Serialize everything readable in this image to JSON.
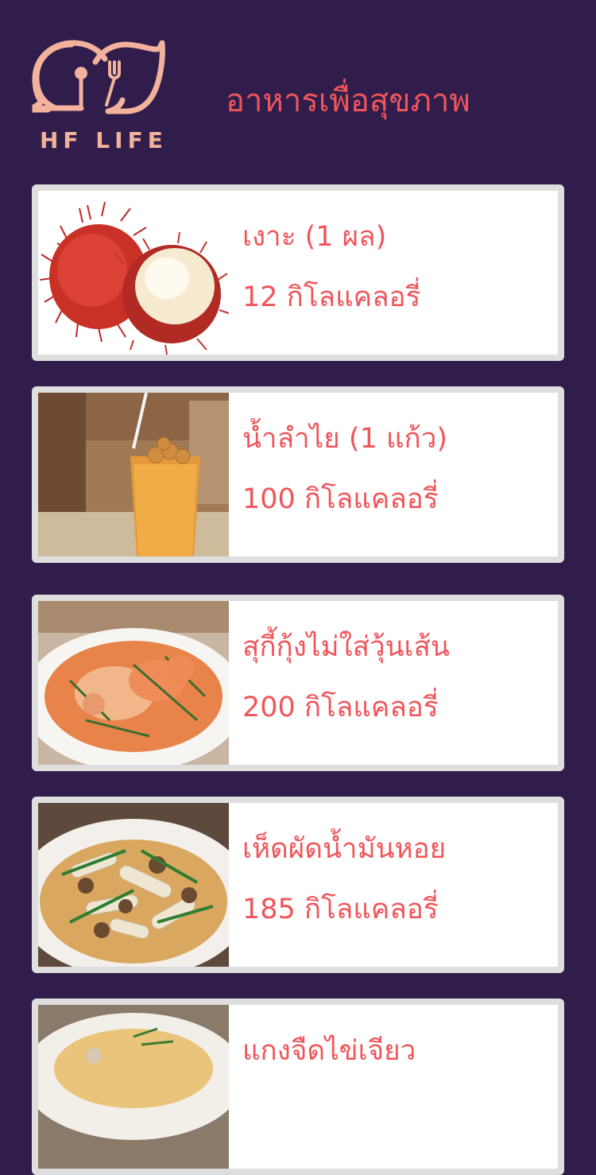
{
  "header": {
    "logo_text": "HF LIFE",
    "title": "อาหารเพื่อสุขภาพ"
  },
  "foods": [
    {
      "name": "เงาะ (1 ผล)",
      "calories": "12 กิโลแคลอรี่",
      "image": "rambutan-photo"
    },
    {
      "name": "น้ำลำไย (1 แก้ว)",
      "calories": "100 กิโลแคลอรี่",
      "image": "longan-drink-photo"
    },
    {
      "name": "สุกี้กุ้งไม่ใส่วุ้นเส้น",
      "calories": "200 กิโลแคลอรี่",
      "image": "shrimp-suki-photo"
    },
    {
      "name": "เห็ดผัดน้ำมันหอย",
      "calories": "185 กิโลแคลอรี่",
      "image": "mushroom-stirfry-photo"
    },
    {
      "name": "แกงจืดไข่เจียว",
      "calories": "",
      "image": "omelette-soup-photo"
    }
  ],
  "colors": {
    "background": "#301d4b",
    "accent": "#f0555a",
    "logo": "#f2b29b",
    "card_border": "#dedede"
  }
}
